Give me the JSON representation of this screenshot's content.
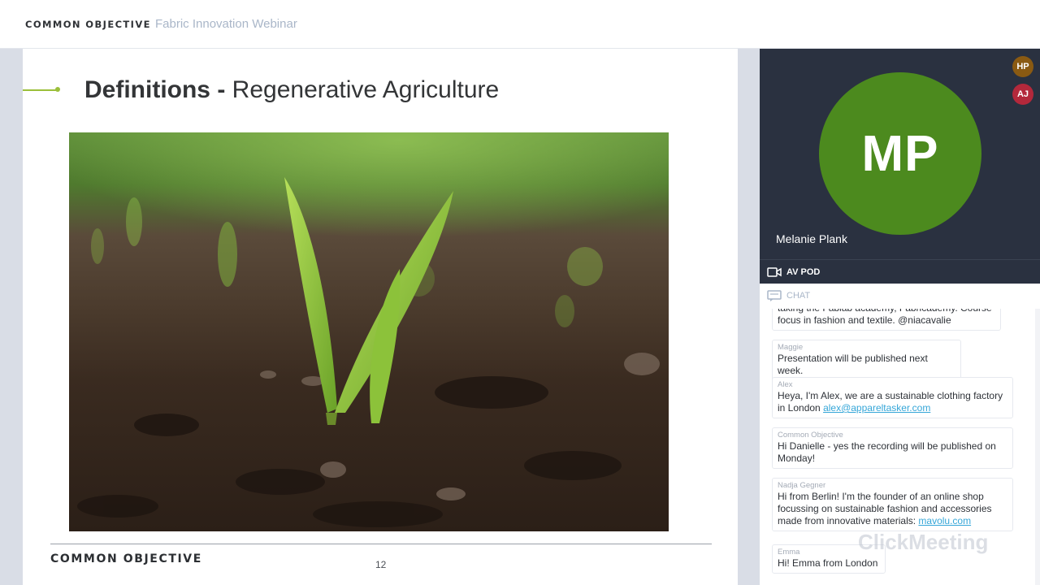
{
  "topbar": {
    "brand": "COMMON OBJECTIVE",
    "webinar_title": "Fabric Innovation Webinar"
  },
  "slide": {
    "heading_bold": "Definitions -",
    "heading_light": "Regenerative Agriculture",
    "footer_brand": "COMMON OBJECTIVE",
    "page_number": "12"
  },
  "av_pod": {
    "presenter_initials": "MP",
    "presenter_name": "Melanie Plank",
    "label": "AV POD",
    "attendees": [
      {
        "initials": "HP",
        "color": "#8a5a12"
      },
      {
        "initials": "AJ",
        "color": "#b3283b"
      }
    ]
  },
  "chat": {
    "label": "CHAT",
    "watermark": "ClickMeeting",
    "messages": [
      {
        "author": "",
        "text": "taking the Fablab academy, Fabricademy. Course\nfocus in fashion and textile. @niacavalie",
        "link": ""
      },
      {
        "author": "Maggie",
        "text": "Presentation will be published next week.",
        "link": ""
      },
      {
        "author": "Alex",
        "text": "Heya, I'm Alex, we are a sustainable clothing factory\nin London ",
        "link": "alex@appareltasker.com"
      },
      {
        "author": "Common Objective",
        "text": "Hi Danielle - yes the recording will be published on\nMonday!",
        "link": ""
      },
      {
        "author": "Nadja Gegner",
        "text": "Hi from Berlin! I'm the founder of an online shop\nfocussing on sustainable fashion and accessories\nmade from innovative materials: ",
        "link": "mavolu.com"
      },
      {
        "author": "Emma",
        "text": "Hi! Emma from London",
        "link": ""
      }
    ]
  },
  "colors": {
    "accent_green": "#9bbf3a",
    "presenter_green": "#4c8a1e",
    "av_background": "#2a3140",
    "link_blue": "#35a6d8"
  }
}
